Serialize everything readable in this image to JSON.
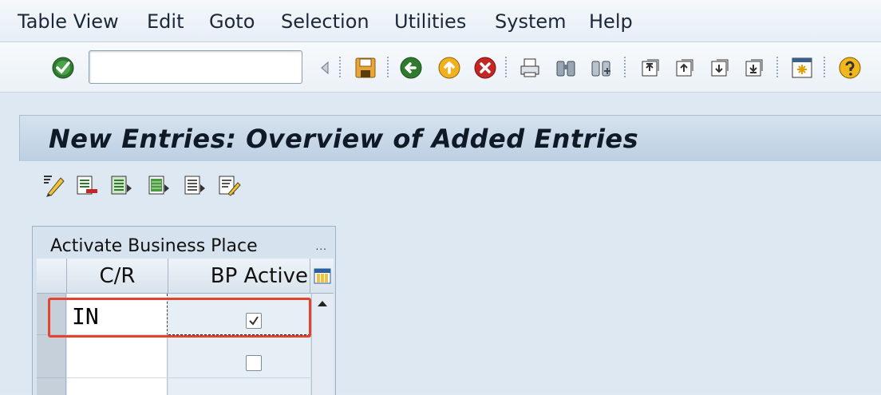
{
  "menubar": {
    "items": [
      "Table View",
      "Edit",
      "Goto",
      "Selection",
      "Utilities",
      "System",
      "Help"
    ]
  },
  "toolbar": {
    "command_field_value": "",
    "icons": [
      "enter-icon",
      "collapse-arrow-icon",
      "save-icon",
      "back-icon",
      "exit-icon",
      "cancel-icon",
      "print-icon",
      "find-icon",
      "find-next-icon",
      "first-page-icon",
      "previous-page-icon",
      "next-page-icon",
      "last-page-icon",
      "create-session-icon",
      "help-icon"
    ]
  },
  "screen": {
    "title": "New Entries: Overview of Added Entries"
  },
  "app_toolbar": {
    "icons": [
      "change-display-icon",
      "delete-icon",
      "select-all-icon",
      "select-block-icon",
      "deselect-all-icon",
      "details-icon"
    ]
  },
  "table": {
    "title": "Activate Business Place",
    "dots": "...",
    "columns": [
      "C/R",
      "BP Active"
    ],
    "rows": [
      {
        "cr": "IN",
        "bp_active": true
      },
      {
        "cr": "",
        "bp_active": false
      },
      {
        "cr": "",
        "bp_active": false
      }
    ]
  },
  "colors": {
    "highlight": "#e4432d",
    "title_bar": "#c7d7e7",
    "background": "#dde8f3"
  }
}
